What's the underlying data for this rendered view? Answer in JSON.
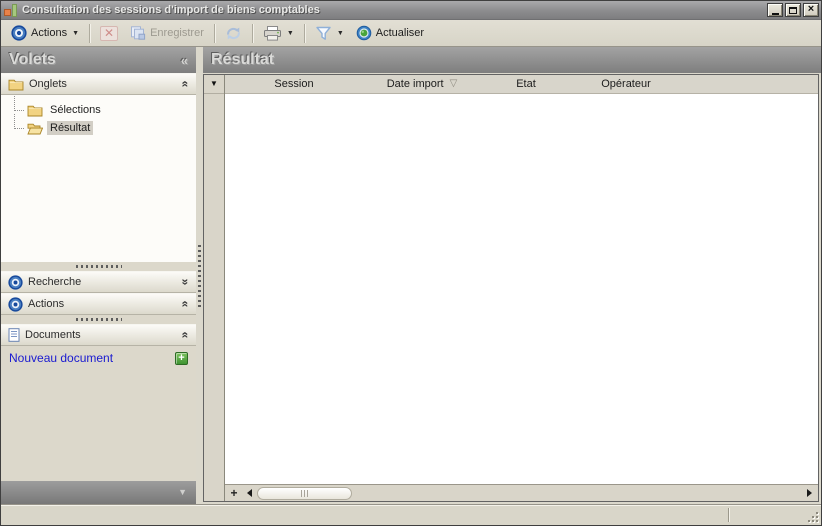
{
  "window": {
    "title": "Consultation des sessions d'import de biens comptables"
  },
  "toolbar": {
    "actions_label": "Actions",
    "save_label": "Enregistrer",
    "refresh_label": "Actualiser"
  },
  "sidebar": {
    "title": "Volets",
    "sections": {
      "onglets": "Onglets",
      "recherche": "Recherche",
      "actions": "Actions",
      "documents": "Documents"
    },
    "tree": [
      {
        "label": "Sélections",
        "selected": false
      },
      {
        "label": "Résultat",
        "selected": true
      }
    ],
    "new_document": "Nouveau document"
  },
  "main": {
    "title": "Résultat",
    "table": {
      "columns": [
        "Session",
        "Date import",
        "Etat",
        "Opérateur"
      ],
      "rows": []
    }
  },
  "icons": {
    "dropdown": "▼",
    "sort_desc": "▽",
    "row_selector": "▼",
    "collapse_sidebar": "«",
    "collapse_section": "«",
    "expand_section": "»",
    "footer_arrow": "▼",
    "close": "×",
    "delete": "✕",
    "plus": "+"
  },
  "colors": {
    "link_blue": "#1a1ad0",
    "accent_blue": "#17499c",
    "folder_yellow": "#f2d382",
    "refresh_green": "#49a53b",
    "titlebar_gray": "#8c8c8e",
    "toolbar_bg": "#dcd9cc"
  }
}
